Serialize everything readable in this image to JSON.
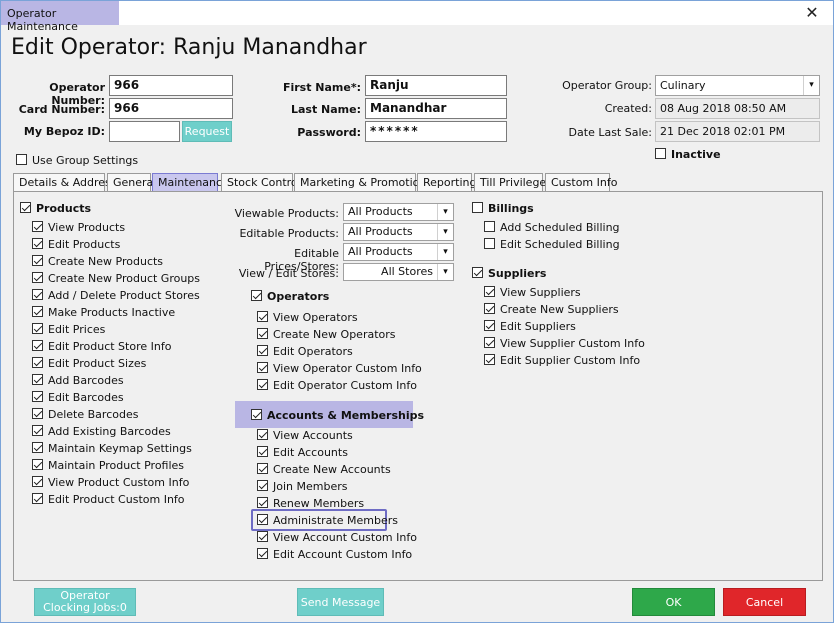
{
  "window": {
    "title": "Operator Maintenance",
    "close_glyph": "✕"
  },
  "heading": "Edit Operator: Ranju Manandhar",
  "form": {
    "operator_number_label": "Operator Number:",
    "operator_number": "966",
    "card_number_label": "Card Number:",
    "card_number": "966",
    "bepoz_id_label": "My Bepoz ID:",
    "bepoz_id": "",
    "request_button": "Request",
    "first_name_label": "First Name*:",
    "first_name": "Ranju",
    "last_name_label": "Last Name:",
    "last_name": "Manandhar",
    "password_label": "Password:",
    "password": "******",
    "operator_group_label": "Operator Group:",
    "operator_group": "Culinary",
    "created_label": "Created:",
    "created": "08 Aug 2018 08:50 AM",
    "date_last_sale_label": "Date Last Sale:",
    "date_last_sale": "21 Dec 2018 02:01 PM",
    "inactive_label": "Inactive",
    "use_group_settings_label": "Use Group Settings"
  },
  "tabs": [
    "Details & Address",
    "General",
    "Maintenance",
    "Stock Control",
    "Marketing & Promotions",
    "Reporting",
    "Till Privileges",
    "Custom Info"
  ],
  "products": {
    "title": "Products",
    "items": [
      "View Products",
      "Edit Products",
      "Create New Products",
      "Create New Product Groups",
      "Add / Delete Product Stores",
      "Make Products Inactive",
      "Edit Prices",
      "Edit Product Store Info",
      "Edit Product Sizes",
      "Add Barcodes",
      "Edit Barcodes",
      "Delete Barcodes",
      "Add Existing Barcodes",
      "Maintain Keymap Settings",
      "Maintain Product Profiles",
      "View Product Custom Info",
      "Edit Product Custom Info"
    ]
  },
  "filters": [
    {
      "label": "Viewable Products:",
      "value": "All Products"
    },
    {
      "label": "Editable Products:",
      "value": "All Products"
    },
    {
      "label": "Editable Prices/Stores:",
      "value": "All Products"
    },
    {
      "label": "View / Edit Stores:",
      "value": "All Stores"
    }
  ],
  "operators": {
    "title": "Operators",
    "items": [
      "View Operators",
      "Create New Operators",
      "Edit Operators",
      "View Operator Custom Info",
      "Edit Operator Custom Info"
    ]
  },
  "accounts": {
    "title": "Accounts & Memberships",
    "items": [
      "View Accounts",
      "Edit Accounts",
      "Create New Accounts",
      "Join Members",
      "Renew Members",
      "Administrate Members",
      "View Account Custom Info",
      "Edit Account Custom Info"
    ]
  },
  "billings": {
    "title": "Billings",
    "items": [
      "Add Scheduled Billing",
      "Edit Scheduled Billing"
    ]
  },
  "suppliers": {
    "title": "Suppliers",
    "items": [
      "View Suppliers",
      "Create New Suppliers",
      "Edit Suppliers",
      "View Supplier Custom Info",
      "Edit Supplier Custom Info"
    ]
  },
  "footer": {
    "operator_button_line1": "Operator",
    "operator_button_line2": "Clocking Jobs:0",
    "send_message": "Send Message",
    "ok": "OK",
    "cancel": "Cancel"
  },
  "colors": {
    "accent": "#b9b6e4",
    "teal": "#6fcfca",
    "ok_green": "#2ea84a",
    "cancel_red": "#e0262a"
  }
}
